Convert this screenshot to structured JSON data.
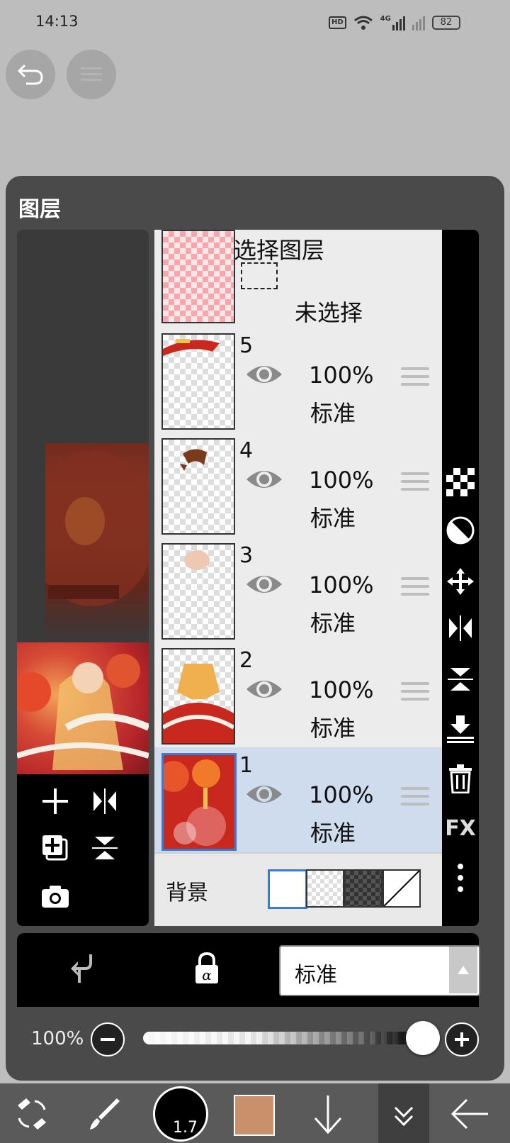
{
  "status_bar": {
    "time": "14:13",
    "network_badge": "HD",
    "signal": "4G",
    "battery": "82"
  },
  "top_controls": {
    "undo_icon": "undo-icon",
    "redo_icon": "redo-icon"
  },
  "panel": {
    "title": "图层"
  },
  "selection_layer": {
    "title": "选择图层",
    "status": "未选择"
  },
  "layers": [
    {
      "number": "5",
      "opacity": "100%",
      "blend_mode": "标准",
      "selected": false
    },
    {
      "number": "4",
      "opacity": "100%",
      "blend_mode": "标准",
      "selected": false
    },
    {
      "number": "3",
      "opacity": "100%",
      "blend_mode": "标准",
      "selected": false
    },
    {
      "number": "2",
      "opacity": "100%",
      "blend_mode": "标准",
      "selected": false
    },
    {
      "number": "1",
      "opacity": "100%",
      "blend_mode": "标准",
      "selected": true
    }
  ],
  "background": {
    "label": "背景",
    "options": [
      "white",
      "transparent",
      "dark-checker",
      "none"
    ],
    "selected": "white"
  },
  "right_strip_icons": [
    "checker-icon",
    "invert-icon",
    "move-icon",
    "flip-horizontal-icon",
    "flip-vertical-icon",
    "merge-down-icon",
    "trash-icon",
    "fx-icon",
    "more-vertical-icon"
  ],
  "right_strip_fx_label": "FX",
  "left_tools": [
    "add-layer-icon",
    "flip-horizontal-icon",
    "copy-layer-icon",
    "flip-vertical-icon",
    "camera-icon"
  ],
  "blend_bar": {
    "clip_icon": "clipping-icon",
    "alpha_lock_icon": "alpha-lock-icon",
    "blend_mode": "标准"
  },
  "opacity": {
    "label": "100%",
    "value": 1.0
  },
  "bottom_toolbar": {
    "brush_size": "1.7",
    "color": "#c9906c",
    "icons": [
      "transform-tool-icon",
      "brush-icon",
      "brush-size-icon",
      "color-swatch",
      "arrow-down-icon",
      "hide-panel-icon",
      "back-arrow-icon"
    ]
  },
  "colors": {
    "selected_layer_bg": "#cfdced",
    "selected_border": "#3a7bd5",
    "panel_bg": "#4a4a4a"
  }
}
